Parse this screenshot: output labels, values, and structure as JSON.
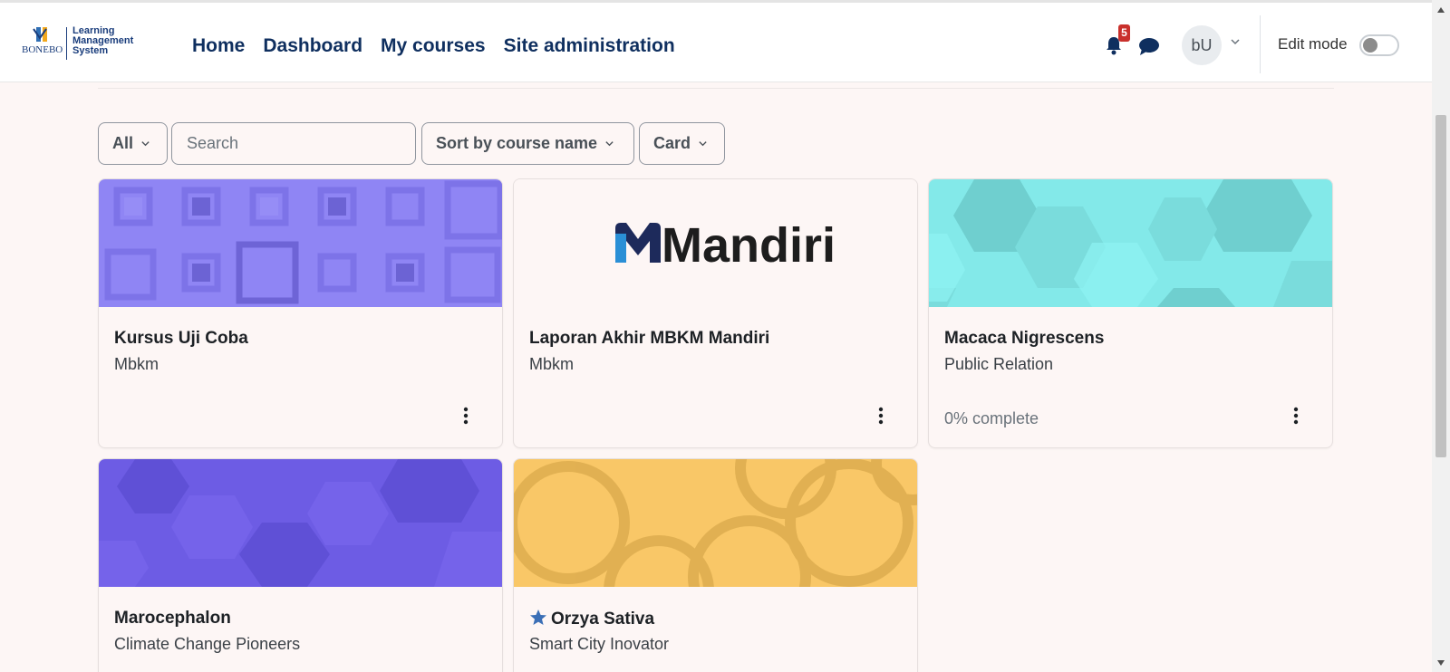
{
  "brand": {
    "logo_name": "BONEBOL",
    "logo_sub": "BONEBOL",
    "line1": "Learning",
    "line2": "Management",
    "line3": "System"
  },
  "nav": {
    "items": [
      {
        "label": "Home"
      },
      {
        "label": "Dashboard"
      },
      {
        "label": "My courses"
      },
      {
        "label": "Site administration"
      }
    ]
  },
  "header": {
    "notification_count": "5",
    "avatar_initials": "bU",
    "edit_mode_label": "Edit mode",
    "edit_mode_on": false
  },
  "filters": {
    "grouping": "All",
    "search_placeholder": "Search",
    "sort": "Sort by course name",
    "view": "Card"
  },
  "courses": [
    {
      "title": "Kursus Uji Coba",
      "category": "Mbkm",
      "progress": "",
      "starred": false,
      "image": "purple-squares"
    },
    {
      "title": "Laporan Akhir MBKM Mandiri",
      "category": "Mbkm",
      "progress": "",
      "starred": false,
      "image": "mandiri-logo",
      "image_text": "Mandiri"
    },
    {
      "title": "Macaca Nigrescens",
      "category": "Public Relation",
      "progress": "0% complete",
      "starred": false,
      "image": "teal-hexagons"
    },
    {
      "title": "Marocephalon",
      "category": "Climate Change Pioneers",
      "progress": "",
      "starred": false,
      "image": "indigo-hexagons"
    },
    {
      "title": "Orzya Sativa",
      "category": "Smart City Inovator",
      "progress": "",
      "starred": true,
      "image": "yellow-circles"
    }
  ],
  "colors": {
    "nav_text": "#0f2f5f",
    "background": "#fdf6f5",
    "badge": "#c9302c",
    "star": "#3b6fb6"
  }
}
